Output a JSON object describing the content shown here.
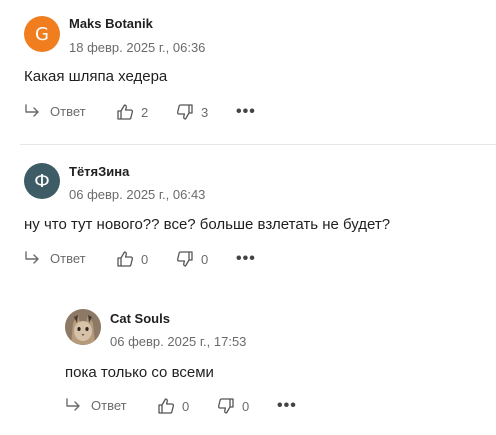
{
  "comments": [
    {
      "avatar_letter": "G",
      "avatar_color": "#f07d1e",
      "author": "Maks Botanik",
      "date": "18 февр. 2025 г., 06:36",
      "text": "Какая шляпа хедера",
      "reply_label": "Ответ",
      "likes": "2",
      "dislikes": "3"
    },
    {
      "avatar_letter": "Ф",
      "avatar_color": "#3d5c66",
      "author": "ТётяЗина",
      "date": "06 февр. 2025 г., 06:43",
      "text": "ну что тут нового?? все? больше взлетать не будет?",
      "reply_label": "Ответ",
      "likes": "0",
      "dislikes": "0"
    },
    {
      "avatar_letter": "",
      "avatar_color": "#a7876b",
      "author": "Cat Souls",
      "date": "06 февр. 2025 г., 17:53",
      "text": "пока только со всеми",
      "reply_label": "Ответ",
      "likes": "0",
      "dislikes": "0"
    }
  ],
  "icons": {
    "reply": "reply-arrow-icon",
    "like": "thumbs-up-icon",
    "dislike": "thumbs-down-icon",
    "more": "more-dots-icon"
  }
}
